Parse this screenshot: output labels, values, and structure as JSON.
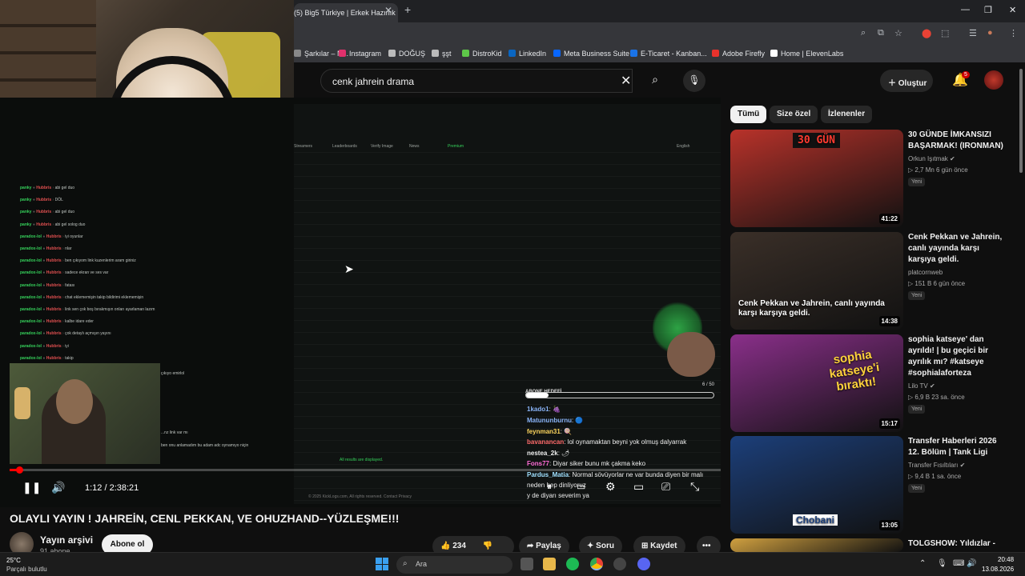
{
  "browser": {
    "tab_title": "(5) Big5 Türkiye | Erkek Hazırlık",
    "tab_close": "✕",
    "new_tab": "+",
    "window_controls": [
      "—",
      "❐",
      "✕"
    ],
    "bookmarks": [
      {
        "label": "Şarkılar – N...",
        "color": "#888888"
      },
      {
        "label": "Instagram",
        "color": "#e1306c"
      },
      {
        "label": "DOĞUŞ",
        "color": "#bbbbbb"
      },
      {
        "label": "şşt",
        "color": "#bbbbbb"
      },
      {
        "label": "DistroKid",
        "color": "#5ec849"
      },
      {
        "label": "LinkedIn",
        "color": "#0a66c2"
      },
      {
        "label": "Meta Business Suite",
        "color": "#0866ff"
      },
      {
        "label": "E-Ticaret - Kanban...",
        "color": "#1a73e8"
      },
      {
        "label": "Adobe Firefly",
        "color": "#e8322c"
      },
      {
        "label": "Home | ElevenLabs",
        "color": "#ffffff"
      }
    ]
  },
  "header": {
    "search_query": "cenk jahrein drama",
    "clear_icon": "✕",
    "search_icon": "⌕",
    "mic_icon": "🎙",
    "create_label": "Oluştur",
    "notification_count": "5"
  },
  "player": {
    "current_time": "1:12 / 2:38:21",
    "progress_fraction": 0.0076,
    "inner_nav": [
      "Streamers",
      "Leaderboards",
      "Verify Image",
      "News",
      "Premium",
      "English"
    ],
    "logs": [
      {
        "user": "panky",
        "mod": "Hubbris",
        "msg": "abi gel duo"
      },
      {
        "user": "panky",
        "mod": "Hubbris",
        "msg": "DÖL"
      },
      {
        "user": "panky",
        "mod": "Hubbris",
        "msg": "abi gel duo"
      },
      {
        "user": "panky",
        "mod": "Hubbris",
        "msg": "abi gel solog duo"
      },
      {
        "user": "paradox-lol",
        "mod": "Hubbris",
        "msg": "iyi oyunlar"
      },
      {
        "user": "paradox-lol",
        "mod": "Hubbris",
        "msg": "nlar"
      },
      {
        "user": "paradox-lol",
        "mod": "Hubbris",
        "msg": "ben çıkıyom link kuzenlerim aram giriniz"
      },
      {
        "user": "paradox-lol",
        "mod": "Hubbris",
        "msg": "sadece ekran ve ses var"
      },
      {
        "user": "paradox-lol",
        "mod": "Hubbris",
        "msg": "fatası"
      },
      {
        "user": "paradox-lol",
        "mod": "Hubbris",
        "msg": "chat eklememişin takip bildirimi eklememişin"
      },
      {
        "user": "paradox-lol",
        "mod": "Hubbris",
        "msg": "link sen çok boş bırakmışın onları ayarlaman lazım"
      },
      {
        "user": "paradox-lol",
        "mod": "Hubbris",
        "msg": "kalbe idare eder"
      },
      {
        "user": "paradox-lol",
        "mod": "Hubbris",
        "msg": "çok detaylı açmışın yayını"
      },
      {
        "user": "paradox-lol",
        "mod": "Hubbris",
        "msg": "iyi"
      },
      {
        "user": "paradox-lol",
        "mod": "Hubbris",
        "msg": "takip"
      }
    ],
    "log_tail": [
      "çıkıyo emirlol",
      "...nz link var mı",
      "ben onu anlamadım bu adam adc oynamıyo niçin"
    ],
    "all_results": "All results are displayed.",
    "footer": "© 2025 KickLogs.com, All rights reserved.   Contact   Privacy",
    "sub_goal_label": "ABONE HEDEFİ",
    "sub_goal_value": "6 / 50",
    "sub_goal_fraction": 0.12,
    "chat": [
      {
        "name": "1kado1",
        "color": "#8ab4f8",
        "text": ": 🍇"
      },
      {
        "name": "Matununburnu",
        "color": "#8ab4f8",
        "text": ": 🔵"
      },
      {
        "name": "feynman31",
        "color": "#ffd75e",
        "text": ": 🍭"
      },
      {
        "name": "bavanancan",
        "color": "#ff6b6b",
        "text": ": lol oynamaktan beyni yok olmuş dalyarrak"
      },
      {
        "name": "nestea_2k",
        "color": "#f1f1f1",
        "text": ": 🌶"
      },
      {
        "name": "Fons77",
        "color": "#ff6bd6",
        "text": ": Diyar siker bunu mk çakma keko"
      },
      {
        "name": "Pardus_Matia",
        "color": "#a0e0ff",
        "text": ": Normal sövüyorlar ne var bunda diyen bir malı"
      },
      {
        "name": "",
        "color": "#f1f1f1",
        "text": "neden hep dinliyoruz"
      },
      {
        "name": "",
        "color": "#f1f1f1",
        "text": "y de diyarı severim ya"
      }
    ]
  },
  "video": {
    "title": "OLAYLI YAYIN ! JAHREİN, CENL PEKKAN, VE OHUZHAND--YÜZLEŞME!!!",
    "channel": "Yayın arşivi",
    "subs": "91 abone",
    "subscribe": "Abone ol",
    "likes": "234",
    "share": "Paylaş",
    "ask": "Soru",
    "save": "Kaydet",
    "more": "•••"
  },
  "chips": [
    "Tümü",
    "Size özel",
    "İzlenenler"
  ],
  "recommendations": [
    {
      "title": "30 GÜNDE İMKANSIZI BAŞARMAK! (IRONMAN)",
      "channel": "Orkun Işıtmak ✔",
      "meta": "▷ 2,7 Mn  6 gün önce",
      "badge": "Yeni",
      "duration": "41:22",
      "thumb_text": "30 GÜN",
      "thumb_bg": "#b8322a"
    },
    {
      "title": "Cenk Pekkan ve Jahrein, canlı yayında karşı karşıya geldi.",
      "channel": "platcornweb",
      "meta": "▷ 151 B  6 gün önce",
      "badge": "Yeni",
      "duration": "14:38",
      "thumb_text": "Cenk Pekkan ve Jahrein, canlı yayında karşı karşıya geldi.",
      "thumb_bg": "#3a2f28"
    },
    {
      "title": "sophia katseye' dan ayrıldı! | bu geçici bir ayrılık mı? #katseye #sophialaforteza",
      "channel": "Lilo TV ✔",
      "meta": "▷ 6,9 B  23 sa. önce",
      "badge": "Yeni",
      "duration": "15:17",
      "thumb_text": "sophia katseye'i bıraktı!",
      "thumb_bg": "#8a2f8a"
    },
    {
      "title": "Transfer Haberleri 2026 12. Bölüm | Tank Ligi",
      "channel": "Transfer Fısıltıları ✔",
      "meta": "▷ 9,4 B  1 sa. önce",
      "badge": "Yeni",
      "duration": "13:05",
      "thumb_text": "Chobani",
      "thumb_bg": "#1c3f7a"
    },
    {
      "title": "TOLGSHOW: Yıldızlar -",
      "channel": "",
      "meta": "",
      "badge": "",
      "duration": "",
      "thumb_text": "",
      "thumb_bg": "#d0a040"
    }
  ],
  "taskbar": {
    "weather_temp": "25°C",
    "weather_desc": "Parçalı bulutlu",
    "search_label": "Ara",
    "time": "20:48",
    "date": "13.08.2026"
  }
}
